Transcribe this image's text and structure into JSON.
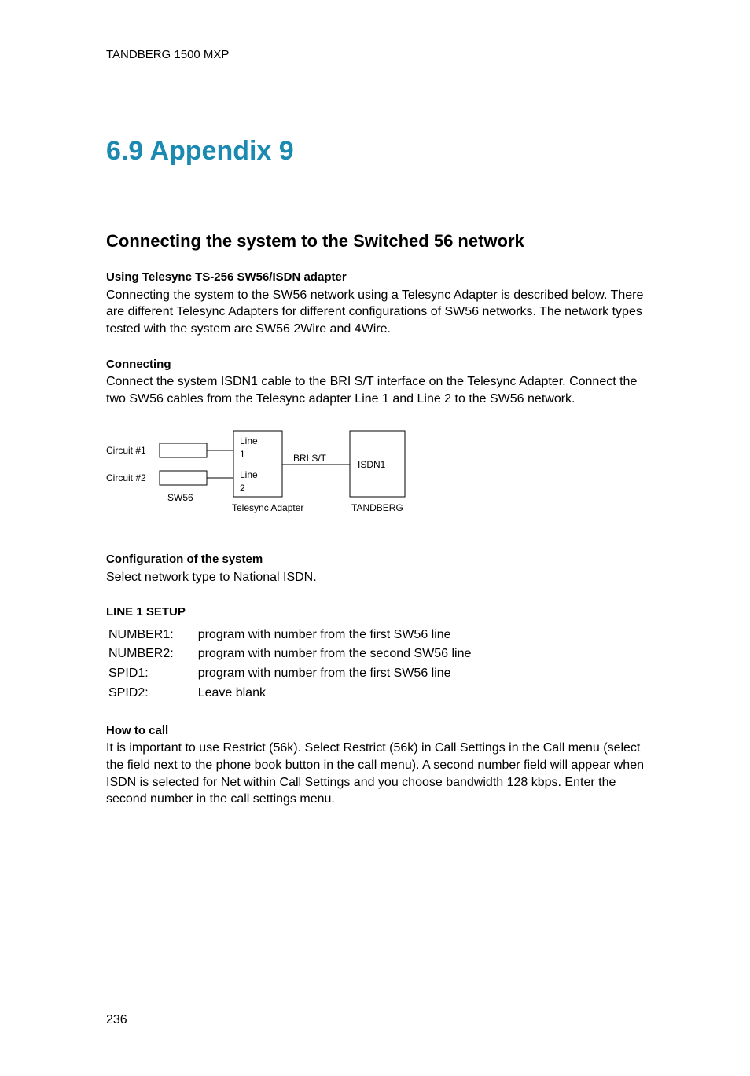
{
  "header": "TANDBERG 1500 MXP",
  "appendix_title": "6.9 Appendix 9",
  "section_title": "Connecting the system to the Switched 56 network",
  "sub1_heading": "Using Telesync TS-256 SW56/ISDN adapter",
  "sub1_text": "Connecting the system to the SW56 network using a Telesync Adapter is described below. There are different Telesync Adapters for different configurations of SW56 networks. The network types tested with the system are SW56 2Wire and 4Wire.",
  "sub2_heading": "Connecting",
  "sub2_text": "Connect the system ISDN1 cable to the BRI S/T interface on the Telesync Adapter. Connect the two SW56 cables from the Telesync adapter Line 1 and Line 2 to the SW56 network.",
  "diagram": {
    "circuit1": "Circuit #1",
    "circuit2": "Circuit #2",
    "sw56": "SW56",
    "line1": "Line",
    "line1_num": "1",
    "line2": "Line",
    "line2_num": "2",
    "brist": "BRI S/T",
    "isdn1": "ISDN1",
    "telesync": "Telesync Adapter",
    "tandberg": "TANDBERG"
  },
  "sub3_heading": "Configuration of the system",
  "sub3_text": "Select network type to National ISDN.",
  "line1_setup_heading": "LINE 1 SETUP",
  "line1_rows": {
    "r1k": "NUMBER1:",
    "r1v": "program with number from the first SW56 line",
    "r2k": "NUMBER2:",
    "r2v": "program with number from the second SW56 line",
    "r3k": "SPID1:",
    "r3v": "program with number from the first SW56 line",
    "r4k": "SPID2:",
    "r4v": "Leave blank"
  },
  "sub4_heading": "How to call",
  "sub4_text": "It is important to use Restrict (56k). Select Restrict (56k) in Call Settings in the Call menu (select the field next to the phone book button in the call menu). A second number field will appear when ISDN is selected for Net within Call Settings and you choose bandwidth 128 kbps. Enter the second number in the call settings menu.",
  "page_number": "236"
}
